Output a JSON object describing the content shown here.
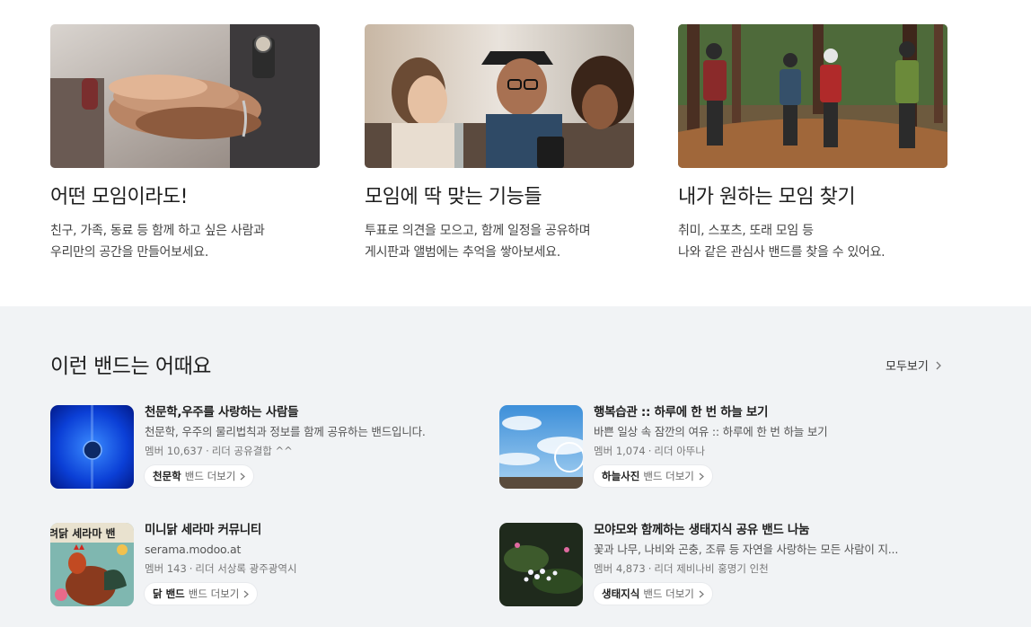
{
  "features": [
    {
      "title": "어떤 모임이라도!",
      "line1": "친구, 가족, 동료 등 함께 하고 싶은 사람과",
      "line2": "우리만의 공간을 만들어보세요."
    },
    {
      "title": "모임에 딱 맞는 기능들",
      "line1": "투표로 의견을 모으고, 함께 일정을 공유하며",
      "line2": "게시판과 앨범에는 추억을 쌓아보세요."
    },
    {
      "title": "내가 원하는 모임 찾기",
      "line1": "취미, 스포츠, 또래 모임 등",
      "line2": "나와 같은 관심사 밴드를 찾을 수 있어요."
    }
  ],
  "recommend": {
    "title": "이런 밴드는 어때요",
    "see_all": "모두보기",
    "bands": [
      {
        "name": "천문학,우주를 사랑하는 사람들",
        "desc": "천문학, 우주의 물리법칙과 정보를 함께 공유하는 밴드입니다.",
        "members": "멤버 10,637",
        "leader": "리더 공유결합 ^^",
        "tag": "천문학",
        "more": "밴드 더보기"
      },
      {
        "name": "행복습관 :: 하루에 한 번 하늘 보기",
        "desc": "바쁜 일상 속 잠깐의 여유 :: 하루에 한 번 하늘 보기",
        "members": "멤버 1,074",
        "leader": "리더 아뚜나",
        "tag": "하늘사진",
        "more": "밴드 더보기"
      },
      {
        "name": "미니닭 세라마 커뮤니티",
        "desc": "serama.modoo.at",
        "members": "멤버 143",
        "leader": "리더 서상록 광주광역시",
        "tag": "닭 밴드",
        "more": "밴드 더보기",
        "cover_text": "려닭 세라마 밴"
      },
      {
        "name": "모야모와 함께하는 생태지식 공유 밴드 나눔",
        "desc": "꽃과 나무, 나비와 곤충, 조류 등 자연을 사랑하는 모든 사람이 지...",
        "members": "멤버 4,873",
        "leader": "리더 제비나비 홍명기 인천",
        "tag": "생태지식",
        "more": "밴드 더보기"
      }
    ]
  },
  "colors": {
    "section_bg": "#f1f3f5",
    "pill_bg": "#ffffff",
    "text": "#1e1e1e"
  },
  "icons": {
    "see_all": "chevron-right-icon",
    "pill": "chevron-right-icon"
  }
}
